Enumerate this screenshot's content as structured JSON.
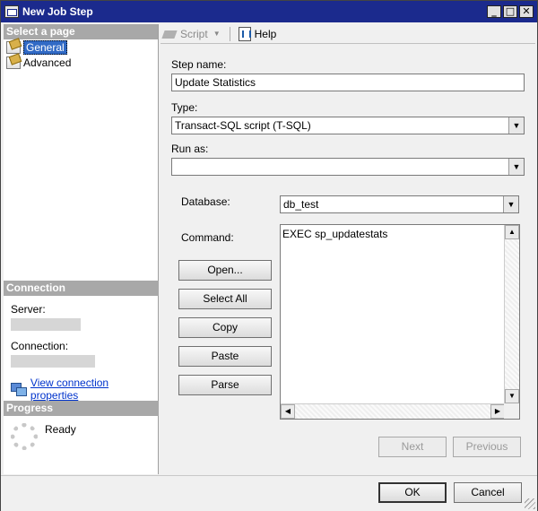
{
  "window": {
    "title": "New Job Step",
    "minimize_glyph": "_",
    "maximize_glyph": "□",
    "close_glyph": "✕"
  },
  "left_pane": {
    "select_page_header": "Select a page",
    "pages": [
      {
        "label": "General",
        "selected": true,
        "icon": "page-icon"
      },
      {
        "label": "Advanced",
        "selected": false,
        "icon": "page-icon"
      }
    ],
    "connection_header": "Connection",
    "server_label": "Server:",
    "connection_label": "Connection:",
    "view_connection_link": "View connection properties",
    "progress_header": "Progress",
    "progress_status": "Ready"
  },
  "toolbar": {
    "script_label": "Script",
    "help_label": "Help"
  },
  "form": {
    "step_name_label": "Step name:",
    "step_name_value": "Update Statistics",
    "type_label": "Type:",
    "type_value": "Transact-SQL script (T-SQL)",
    "run_as_label": "Run as:",
    "run_as_value": "",
    "database_label": "Database:",
    "database_value": "db_test",
    "command_label": "Command:",
    "command_text": "EXEC sp_updatestats"
  },
  "command_buttons": {
    "open": "Open...",
    "select_all": "Select All",
    "copy": "Copy",
    "paste": "Paste",
    "parse": "Parse"
  },
  "navigation": {
    "next": "Next",
    "previous": "Previous"
  },
  "footer": {
    "ok": "OK",
    "cancel": "Cancel"
  },
  "colors": {
    "titlebar": "#1b2a8d",
    "selection": "#316ac5",
    "link": "#0033cc",
    "section_header": "#a8a8a8"
  }
}
